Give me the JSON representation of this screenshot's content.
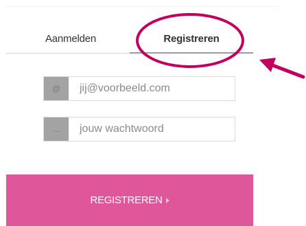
{
  "tabs": {
    "login_label": "Aanmelden",
    "register_label": "Registreren",
    "active": "register"
  },
  "email_field": {
    "addon": "@",
    "placeholder": "jij@voorbeeld.com"
  },
  "password_field": {
    "addon": "...",
    "placeholder": "jouw wachtwoord"
  },
  "submit": {
    "label": "REGISTREREN",
    "icon": "caret-right-icon"
  },
  "annotation": {
    "shape": "ellipse-highlight",
    "pointer": "arrow-icon",
    "color": "#c2005e"
  },
  "colors": {
    "accent": "#e0569a",
    "addon_background": "#a3a3a3"
  }
}
